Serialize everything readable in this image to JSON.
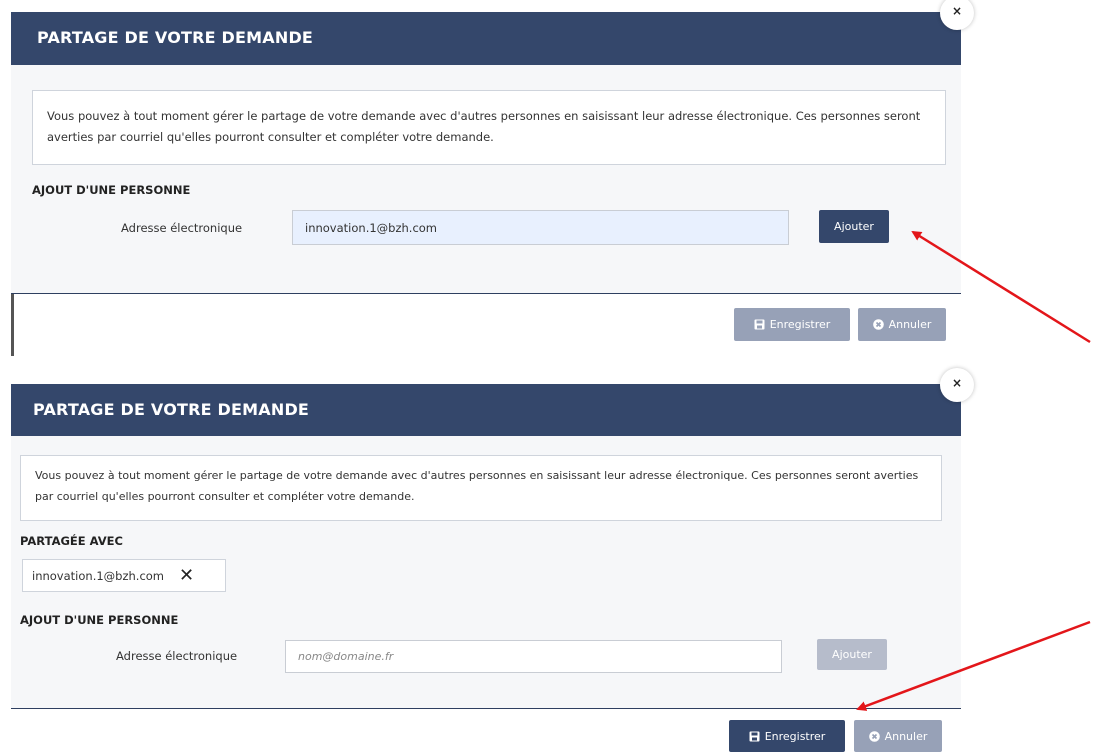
{
  "panel1": {
    "header_title": "PARTAGE DE VOTRE DEMANDE",
    "close_symbol": "×",
    "info_text": "Vous pouvez à tout moment gérer le partage de votre demande avec d'autres personnes en saisissant leur adresse électronique. Ces personnes seront averties par courriel qu'elles pourront consulter et compléter votre demande.",
    "add_section_title": "AJOUT D'UNE PERSONNE",
    "email_label": "Adresse électronique",
    "email_value": "innovation.1@bzh.com",
    "add_button_label": "Ajouter",
    "save_button_label": "Enregistrer",
    "cancel_button_label": "Annuler",
    "save_enabled": false
  },
  "panel2": {
    "header_title": "PARTAGE DE VOTRE DEMANDE",
    "close_symbol": "×",
    "info_text": "Vous pouvez à tout moment gérer le partage de votre demande avec d'autres personnes en saisissant leur adresse électronique. Ces personnes seront averties par courriel qu'elles pourront consulter et compléter votre demande.",
    "shared_section_title": "PARTAGÉE AVEC",
    "shared_with": [
      "innovation.1@bzh.com"
    ],
    "remove_symbol": "✕",
    "add_section_title": "AJOUT D'UNE PERSONNE",
    "email_label": "Adresse électronique",
    "email_placeholder": "nom@domaine.fr",
    "add_button_label": "Ajouter",
    "save_button_label": "Enregistrer",
    "cancel_button_label": "Annuler",
    "save_enabled": true
  },
  "colors": {
    "header": "#34476b",
    "arrow": "#e3161a",
    "disabled_button": "#97a1b7",
    "body_background": "#f6f7f9"
  }
}
